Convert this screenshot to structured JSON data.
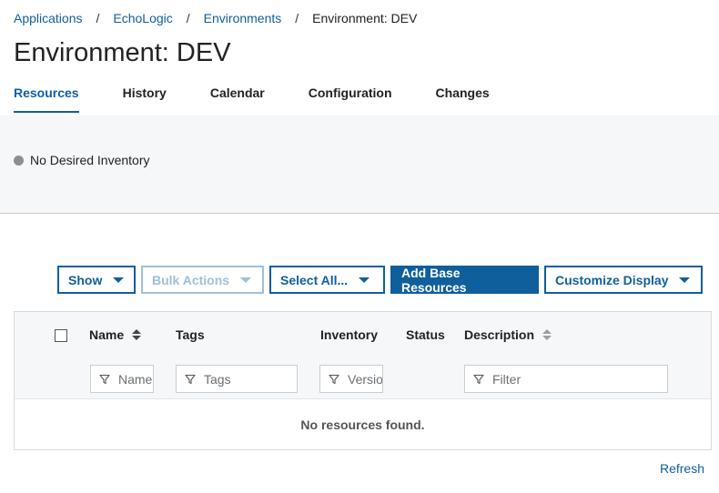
{
  "breadcrumb": [
    "Applications",
    "EchoLogic",
    "Environments",
    "Environment: DEV"
  ],
  "title": "Environment: DEV",
  "tabs": [
    "Resources",
    "History",
    "Calendar",
    "Configuration",
    "Changes"
  ],
  "active_tab": "Resources",
  "inventory_status": "No Desired Inventory",
  "toolbar": {
    "show": "Show",
    "bulk_actions": "Bulk Actions",
    "select_all": "Select All...",
    "add_base_resources": "Add Base Resources",
    "customize_display": "Customize Display"
  },
  "table": {
    "columns": [
      "Name",
      "Tags",
      "Inventory",
      "Status",
      "Description"
    ],
    "filters": {
      "name": "Name",
      "tags": "Tags",
      "inventory": "Version",
      "description": "Filter"
    },
    "empty_message": "No resources found."
  },
  "refresh": "Refresh",
  "colors": {
    "accent": "#0f5f9c",
    "disabled": "#9ec0dc",
    "status_dot": "#8a8f94",
    "panel_bg": "#f5f7f9"
  }
}
